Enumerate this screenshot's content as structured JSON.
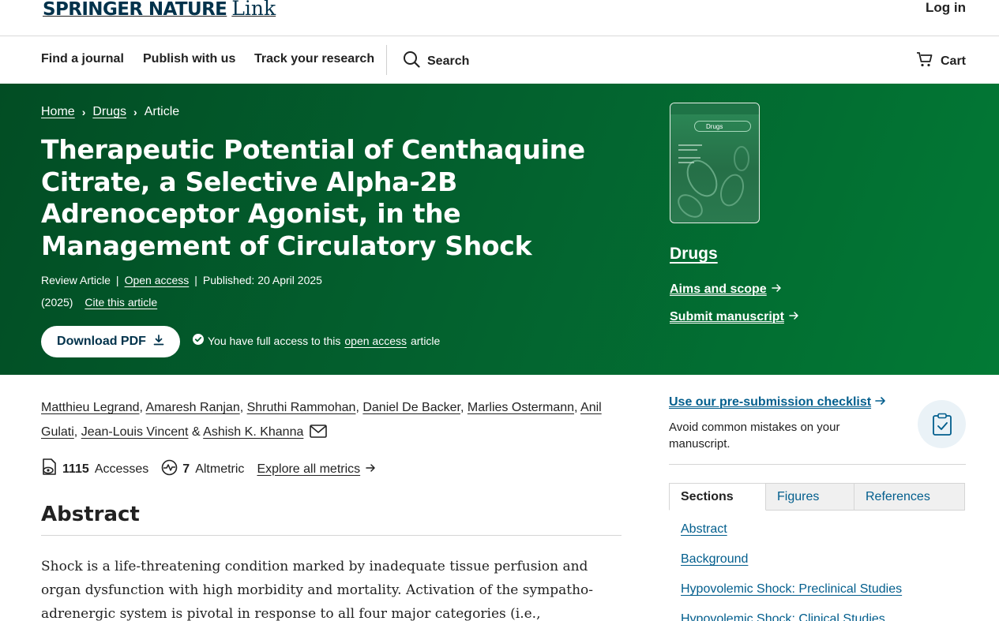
{
  "header": {
    "logo_brand": "SPRINGER NATURE",
    "logo_product": "Link",
    "login_label": "Log in"
  },
  "nav": {
    "items": [
      {
        "label": "Find a journal"
      },
      {
        "label": "Publish with us"
      },
      {
        "label": "Track your research"
      }
    ],
    "search_label": "Search",
    "cart_label": "Cart"
  },
  "breadcrumb": [
    "Home",
    "Drugs",
    "Article"
  ],
  "article": {
    "title": "Therapeutic Potential of Centhaquine Citrate, a Selective Alpha-2B Adrenoceptor Agonist, in the Management of Circulatory Shock",
    "type": "Review Article",
    "open_access": "Open access",
    "published": "Published: 20 April 2025",
    "year": "(2025)",
    "cite": "Cite this article",
    "download_label": "Download PDF",
    "access_prefix": "You have full access to this",
    "access_link": "open access",
    "access_suffix": "article"
  },
  "journal": {
    "cover_title": "Drugs",
    "name": "Drugs",
    "aims_scope": "Aims and scope",
    "submit_manuscript": "Submit manuscript"
  },
  "authors": [
    "Matthieu Legrand",
    "Amaresh Ranjan",
    "Shruthi Rammohan",
    "Daniel De Backer",
    "Marlies Ostermann",
    "Anil Gulati",
    "Jean-Louis Vincent",
    "Ashish K. Khanna"
  ],
  "authors_conjunction": "&",
  "metrics": {
    "accesses_count": "1115",
    "accesses_label": "Accesses",
    "altmetric_count": "7",
    "altmetric_label": "Altmetric",
    "explore_label": "Explore all metrics"
  },
  "abstract": {
    "heading": "Abstract",
    "text": "Shock is a life-threatening condition marked by inadequate tissue perfusion and organ dysfunction with high morbidity and mortality. Activation of the sympatho-adrenergic system is pivotal in response to all four major categories (i.e., hypovolemic, distributive,"
  },
  "sidebar": {
    "checklist_link": "Use our pre-submission checklist",
    "checklist_desc": "Avoid common mistakes on your manuscript.",
    "tabs": [
      "Sections",
      "Figures",
      "References"
    ],
    "sections": [
      "Abstract",
      "Background",
      "Hypovolemic Shock: Preclinical Studies",
      "Hypovolemic Shock: Clinical Studies"
    ]
  },
  "colors": {
    "hero_green": "#03602e",
    "brand_navy": "#01324b",
    "link_blue": "#025e8d"
  }
}
